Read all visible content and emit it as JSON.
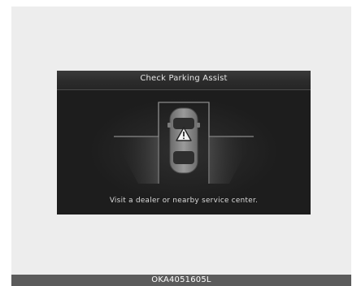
{
  "warning": {
    "title": "Check Parking Assist",
    "message": "Visit a dealer or nearby service center.",
    "icon": "warning-triangle-icon"
  },
  "caption": "OKA4051605L",
  "colors": {
    "screen_background": "#1d1d1d",
    "text": "#e6e6e6",
    "page_background": "#ededed",
    "caption_bar": "#5b5b5b"
  }
}
